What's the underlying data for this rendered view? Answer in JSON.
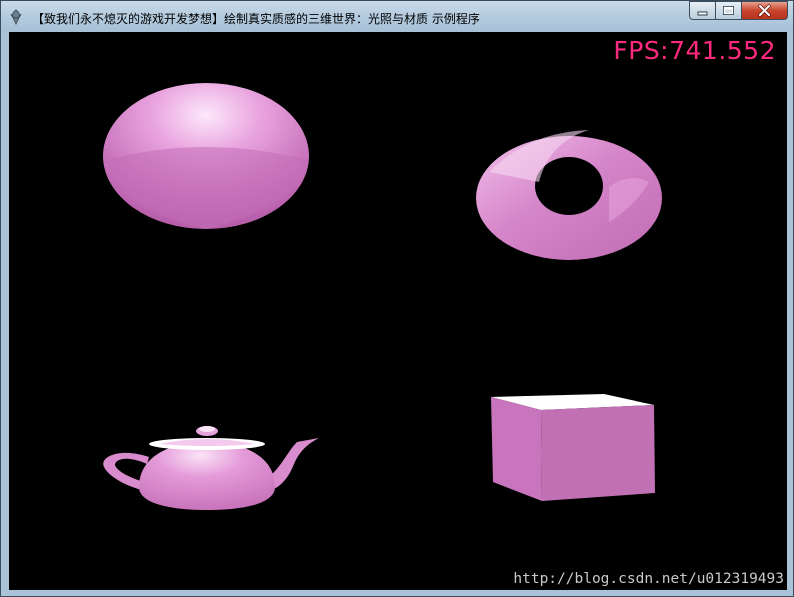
{
  "window": {
    "title": "【致我们永不熄灭的游戏开发梦想】绘制真实质感的三维世界：光照与材质  示例程序",
    "minimize_icon": "minimize-icon",
    "maximize_icon": "maximize-icon",
    "close_icon": "close-icon"
  },
  "overlay": {
    "fps": "FPS:741.552",
    "watermark": "http://blog.csdn.net/u012319493"
  },
  "scene": {
    "objects": [
      "sphere",
      "torus",
      "teapot",
      "cube"
    ],
    "material_color": "#d07ec3",
    "highlight_color": "#ffffff",
    "background_color": "#000000"
  }
}
